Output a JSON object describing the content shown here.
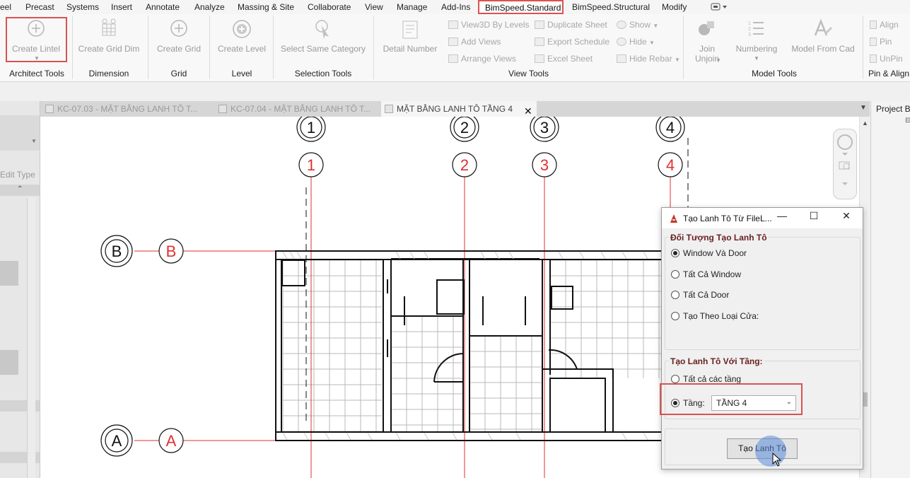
{
  "menu": {
    "items": [
      "eel",
      "Precast",
      "Systems",
      "Insert",
      "Annotate",
      "Analyze",
      "Massing & Site",
      "Collaborate",
      "View",
      "Manage",
      "Add-Ins",
      "BimSpeed.Standard",
      "BimSpeed.Structural",
      "Modify"
    ],
    "active_index": 11,
    "active_color": "#d9534f"
  },
  "ribbon": {
    "groups": {
      "architect": {
        "label": "Architect Tools",
        "buttons": [
          "Create Lintel"
        ]
      },
      "dimension": {
        "label": "Dimension",
        "buttons": [
          "Create Grid Dim"
        ]
      },
      "grid": {
        "label": "Grid",
        "buttons": [
          "Create Grid"
        ]
      },
      "level": {
        "label": "Level",
        "buttons": [
          "Create Level"
        ]
      },
      "selection": {
        "label": "Selection Tools",
        "buttons": [
          "Select Same Category"
        ]
      },
      "view": {
        "label": "View Tools",
        "big": "Detail Number",
        "col1": [
          "View3D By Levels",
          "Add Views",
          "Arrange Views"
        ],
        "col2": [
          "Duplicate Sheet",
          "Export Schedule",
          "Excel Sheet"
        ],
        "col3": [
          "Show",
          "Hide",
          "Hide Rebar"
        ]
      },
      "model": {
        "label": "Model Tools",
        "join": "Join",
        "unjoin": "Unjoin",
        "numbering": "Numbering",
        "model_from_cad": "Model From Cad"
      },
      "pin": {
        "label": "Pin & Align",
        "items": [
          "Align",
          "Pin",
          "UnPin"
        ]
      }
    }
  },
  "left_panel": {
    "edit_type": "Edit Type"
  },
  "tabs": [
    {
      "label": "KC-07.03 - MẶT BẰNG LANH TÔ T...",
      "active": false
    },
    {
      "label": "KC-07.04 - MẶT BẰNG LANH TÔ T...",
      "active": false
    },
    {
      "label": "MẶT BẰNG LANH TÔ TẦNG 4",
      "active": true
    }
  ],
  "tab_close": "✕",
  "right_panel": {
    "title": "Project Br"
  },
  "grids": {
    "vertical": [
      "1",
      "2",
      "3",
      "4"
    ],
    "horizontal": [
      "B",
      "A"
    ],
    "line_color": "#e03030"
  },
  "dialog": {
    "title": "Tạo Lanh Tô Từ FileL...",
    "group1": {
      "title": "Đối Tượng Tạo Lanh Tô",
      "options": [
        "Window Và Door",
        "Tất Cả Window",
        "Tất Cả Door",
        "Tạo Theo Loại Cửa:"
      ],
      "selected": 0
    },
    "group2": {
      "title": "Tạo Lanh Tô Với Tầng:",
      "options": [
        "Tất cả các tầng",
        "Tầng:"
      ],
      "selected": 1,
      "level_value": "TẦNG 4"
    },
    "action": "Tạo Lanh Tô"
  }
}
